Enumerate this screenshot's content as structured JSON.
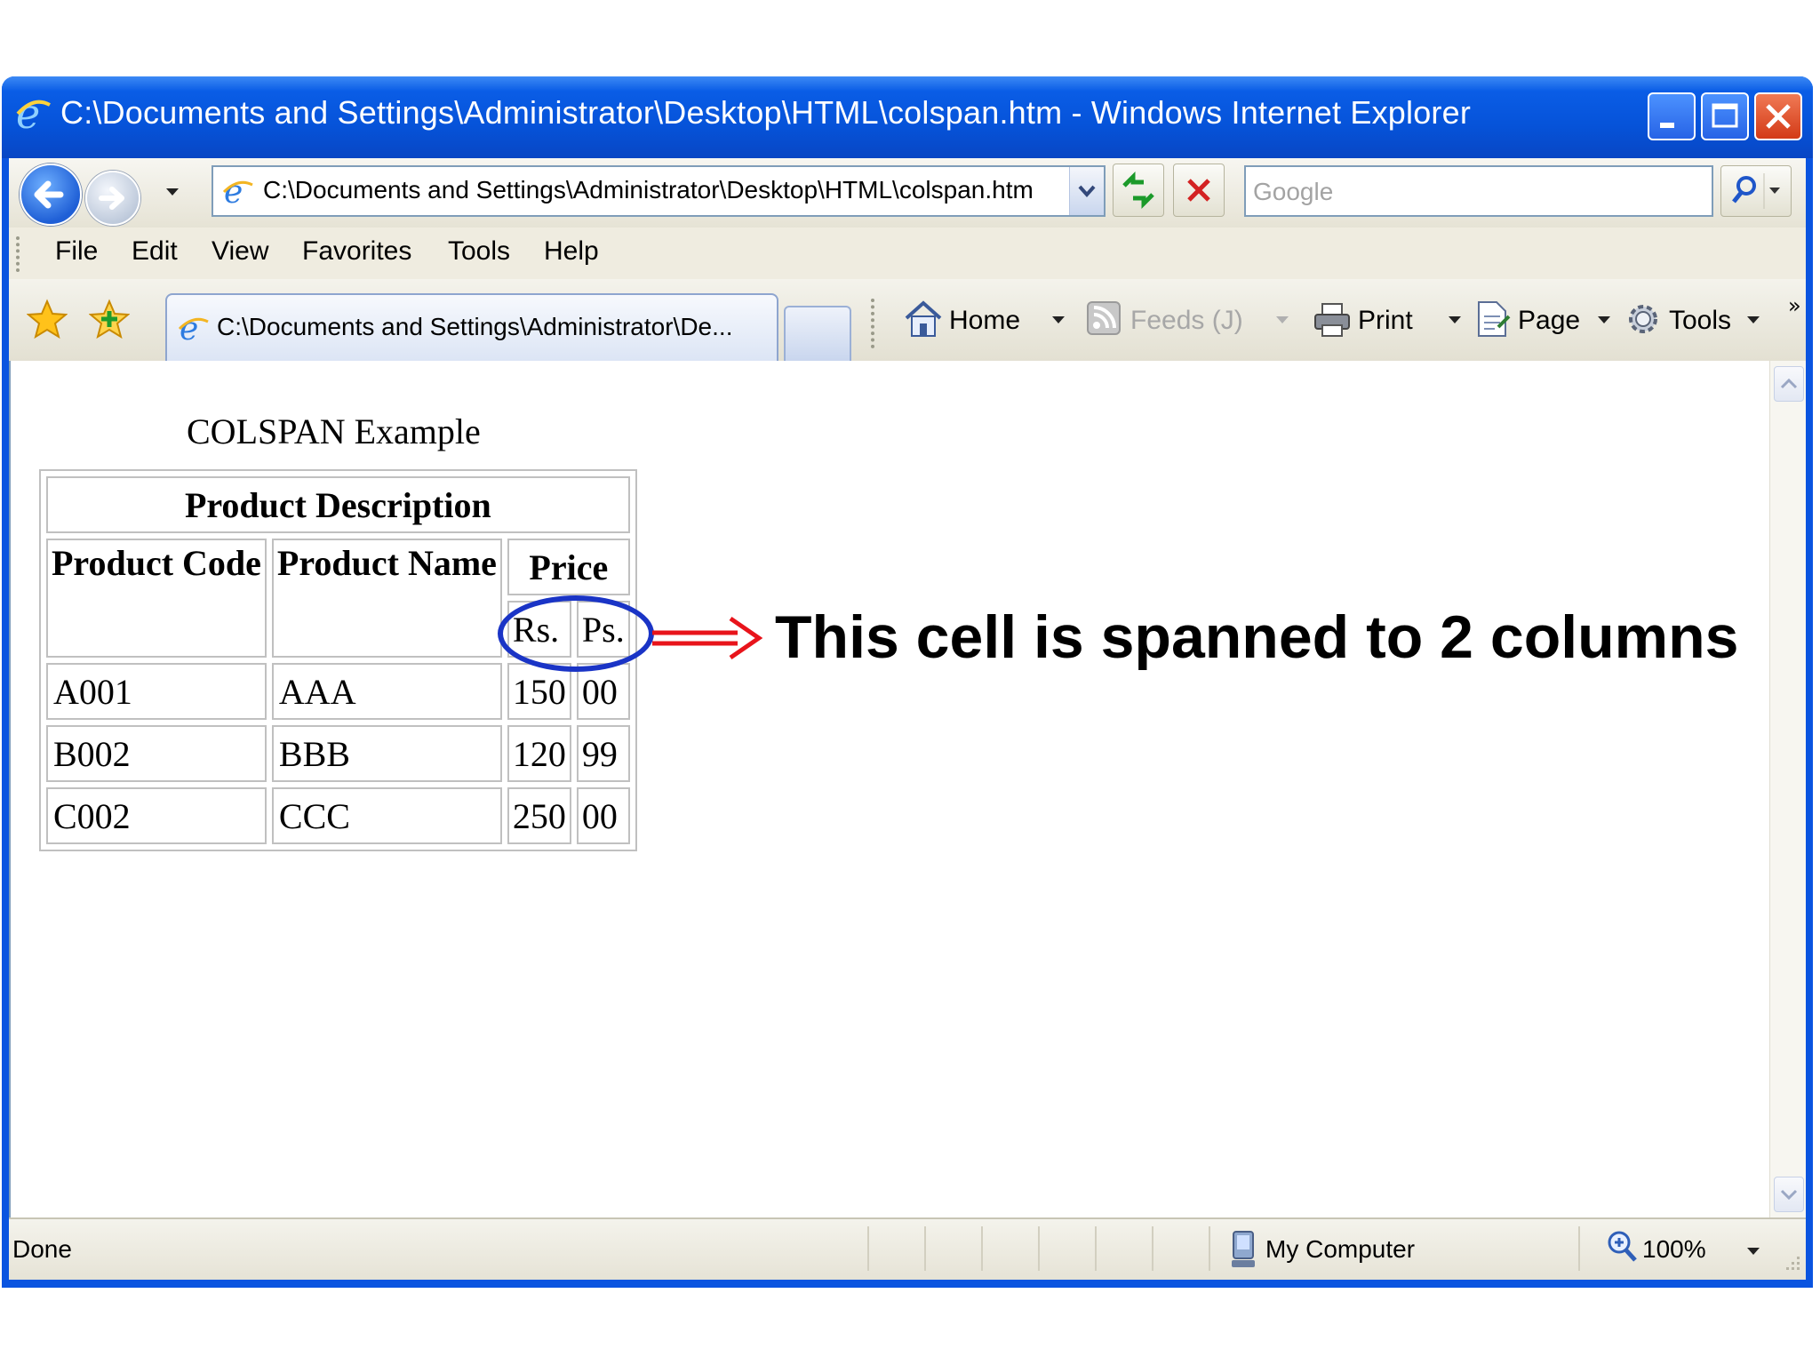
{
  "window": {
    "title": "C:\\Documents and Settings\\Administrator\\Desktop\\HTML\\colspan.htm - Windows Internet Explorer"
  },
  "address_bar": {
    "url": "C:\\Documents and Settings\\Administrator\\Desktop\\HTML\\colspan.htm",
    "search_placeholder": "Google"
  },
  "menu": {
    "items": [
      "File",
      "Edit",
      "View",
      "Favorites",
      "Tools",
      "Help"
    ]
  },
  "tab": {
    "label": "C:\\Documents and Settings\\Administrator\\De..."
  },
  "command_bar": {
    "home": "Home",
    "feeds": "Feeds (J)",
    "print": "Print",
    "page": "Page",
    "tools": "Tools",
    "more": "»"
  },
  "page": {
    "heading": "COLSPAN Example",
    "table": {
      "header": "Product Description",
      "columns": [
        "Product Code",
        "Product Name",
        "Price"
      ],
      "price_subheaders": [
        "Rs.",
        "Ps."
      ],
      "rows": [
        [
          "A001",
          "AAA",
          "150",
          "00"
        ],
        [
          "B002",
          "BBB",
          "120",
          "99"
        ],
        [
          "C002",
          "CCC",
          "250",
          "00"
        ]
      ]
    }
  },
  "annotation": {
    "text": "This cell is spanned to 2 columns",
    "ring_color": "#1a34c6",
    "arrow_color": "#e8141b"
  },
  "status_bar": {
    "status": "Done",
    "zone": "My Computer",
    "zoom": "100%"
  }
}
